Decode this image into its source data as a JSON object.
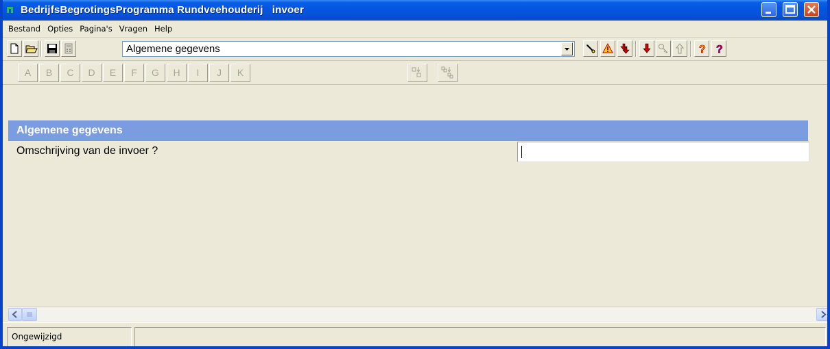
{
  "window": {
    "title": "BedrijfsBegrotingsProgramma Rundveehouderij   invoer"
  },
  "menu": {
    "items": [
      "Bestand",
      "Opties",
      "Pagina's",
      "Vragen",
      "Help"
    ]
  },
  "toolbar": {
    "page_selector_value": "Algemene gegevens",
    "help_glyph": "?"
  },
  "letters": [
    "A",
    "B",
    "C",
    "D",
    "E",
    "F",
    "G",
    "H",
    "I",
    "J",
    "K"
  ],
  "content": {
    "section_title": "Algemene gegevens",
    "question": "Omschrijving van de invoer ?",
    "answer_value": ""
  },
  "statusbar": {
    "state": "Ongewijzigd"
  },
  "colors": {
    "titlebar": "#0556df",
    "section_header": "#7b9ce0",
    "window_bg": "#ece9d8"
  },
  "icons": [
    "app-icon",
    "new-document-icon",
    "open-folder-icon",
    "save-disk-icon",
    "calculator-icon",
    "dropdown-arrow-icon",
    "pen-icon",
    "warning-book-icon",
    "double-arrow-down-icon",
    "arrow-down-icon",
    "key-icon",
    "arrow-up-icon",
    "help-icon",
    "help-context-icon",
    "copy-down-icon",
    "copy-all-down-icon",
    "scroll-left-icon",
    "scroll-right-icon",
    "minimize-icon",
    "maximize-icon",
    "close-icon"
  ]
}
